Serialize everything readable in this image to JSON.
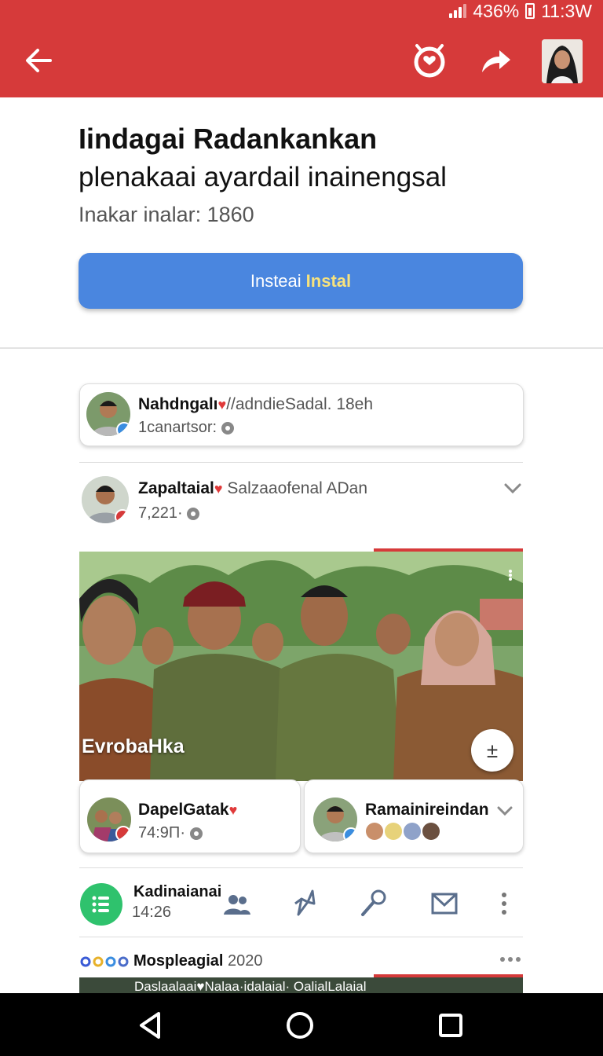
{
  "status_bar": {
    "battery": "436%",
    "time": "11:3W"
  },
  "header": {
    "title": "Iindagai Radankankan",
    "subtitle": "plenakaai ayardail inainengsal",
    "meta": "Inakar inalar: 1860",
    "install_label_a": "Insteai",
    "install_label_b": "Instal"
  },
  "comment_card": {
    "name": "Nahdngalı",
    "handle": "//adndieSadal. 18eh",
    "sub": "1canartsor:"
  },
  "post": {
    "name": "Zapaltaial",
    "handle": "Salzaaofenal ADan",
    "meta": "7,221·",
    "photo_caption": "EvrobaHka"
  },
  "sub_cards": [
    {
      "name": "DapelGatak",
      "meta": "74:9Π·"
    },
    {
      "name": "Ramainireindan"
    }
  ],
  "actions": {
    "label": "Kadinaianai",
    "count": "14:26"
  },
  "next_post": {
    "name": "Mospleagial",
    "year": "2020",
    "peek_text": "Daslaalaai♥Nalaa·idalaial·    OalialLalaial"
  },
  "colors": {
    "app_bar": "#d63a3a",
    "install_button": "#4a86df",
    "green_action": "#2fc26d"
  }
}
